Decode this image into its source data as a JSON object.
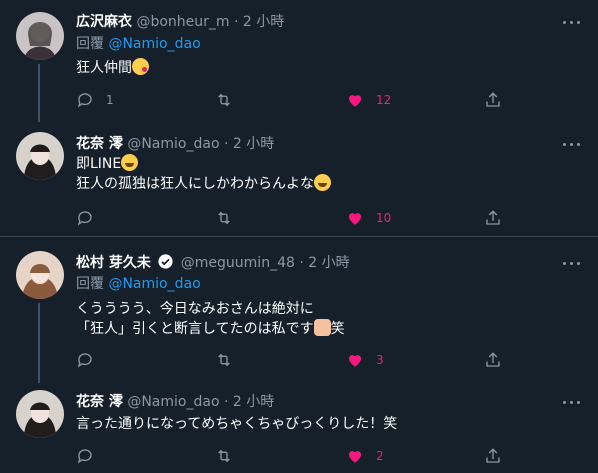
{
  "tweets": [
    {
      "name": "広沢麻衣",
      "handle": "@bonheur_m",
      "time": "· 2 小時",
      "reply_prefix": "回覆",
      "reply_handle": "@Namio_dao",
      "lines": [
        "狂人仲間"
      ],
      "emoji": [
        "kissing-face"
      ],
      "replies": "1",
      "likes": "12",
      "verified": false
    },
    {
      "name": "花奈 澪",
      "handle": "@Namio_dao",
      "time": "· 2 小時",
      "lines": [
        "即LINE",
        "狂人の孤独は狂人にしかわからんよな"
      ],
      "emoji": [
        "tears-of-joy-face",
        "tears-of-joy-face"
      ],
      "replies": "",
      "likes": "10",
      "verified": false
    },
    {
      "name": "松村 芽久未",
      "handle": "@meguumin_48",
      "time": "· 2 小時",
      "reply_prefix": "回覆",
      "reply_handle": "@Namio_dao",
      "lines": [
        "くうううう、今日なみおさんは絶対に",
        "「狂人」引くと断言してたのは私です",
        "笑"
      ],
      "emoji": [
        "person-raising-hand"
      ],
      "replies": "",
      "likes": "3",
      "verified": true
    },
    {
      "name": "花奈 澪",
      "handle": "@Namio_dao",
      "time": "· 2 小時",
      "lines": [
        "言った通りになってめちゃくちゃびっくりした！笑"
      ],
      "replies": "",
      "likes": "2",
      "verified": false
    }
  ],
  "icons": {
    "reply": "reply-icon",
    "retweet": "retweet-icon",
    "like": "heart-icon",
    "share": "share-icon",
    "more": "more-icon",
    "verified": "verified-badge-icon"
  },
  "colors": {
    "background": "#15202b",
    "secondary_text": "#8b98a5",
    "link": "#1d9bf0",
    "like": "#f91880"
  }
}
